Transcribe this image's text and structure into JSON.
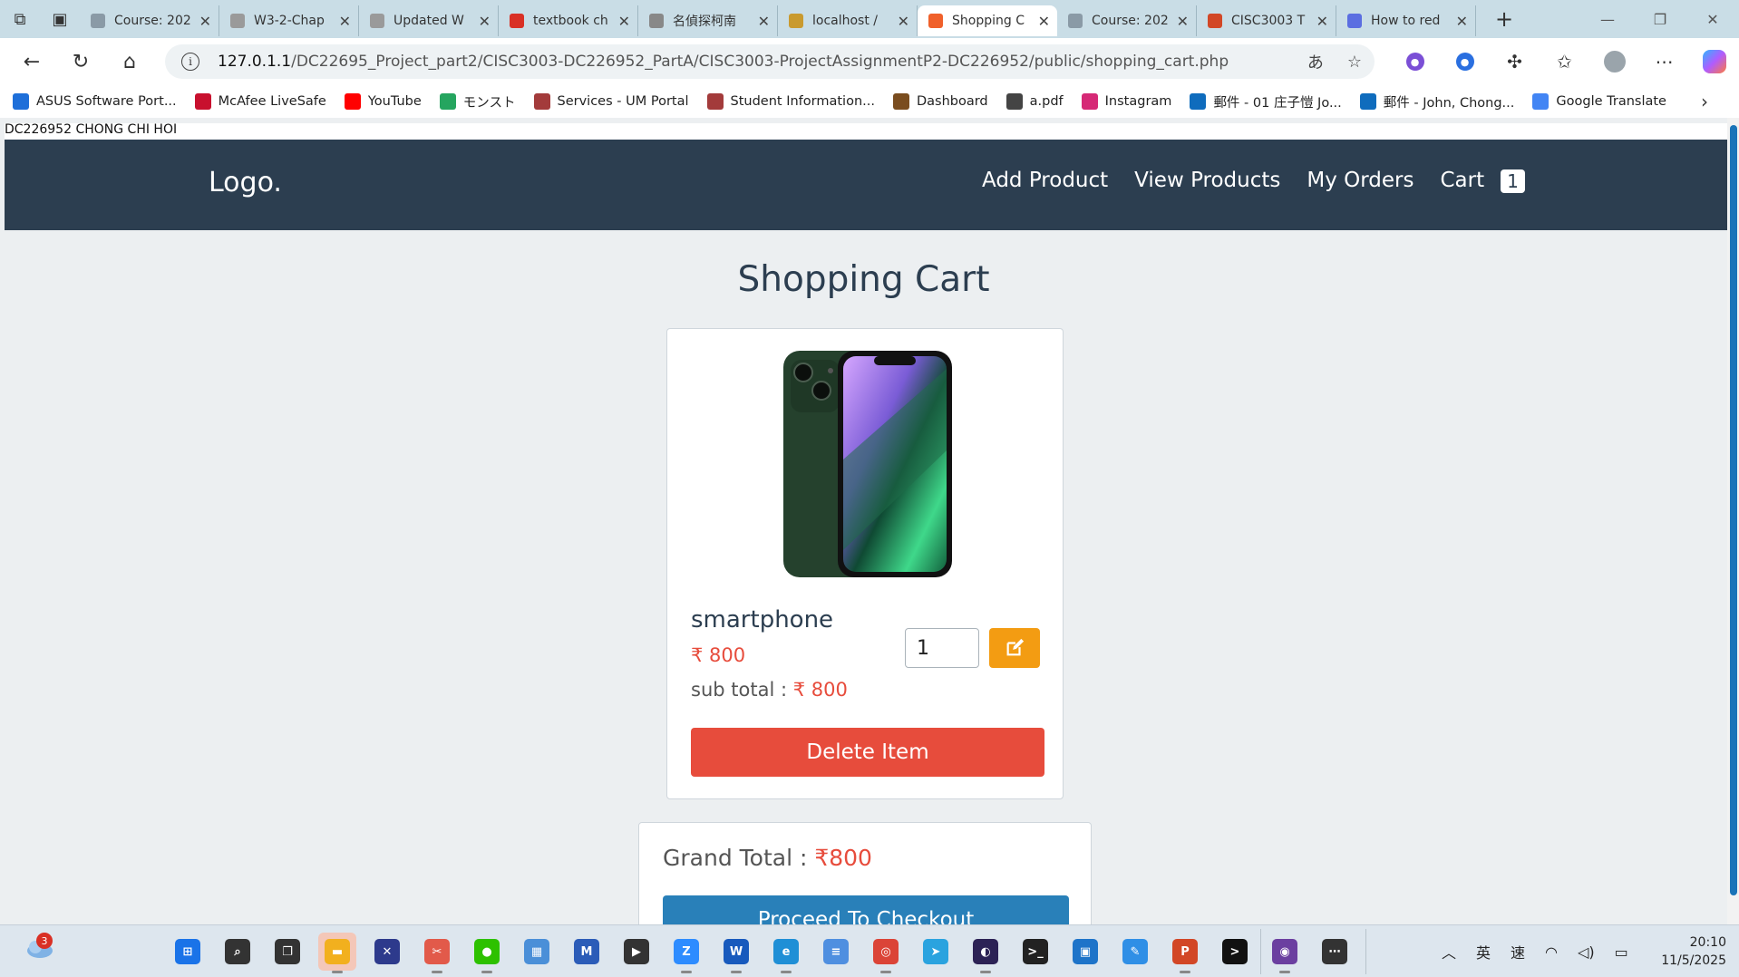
{
  "browser": {
    "tabs": [
      {
        "title": "Course: 202",
        "fav_color": "#8a9aa6",
        "active": false
      },
      {
        "title": "W3-2-Chap",
        "fav_color": "#9a9a9a",
        "active": false
      },
      {
        "title": "Updated W",
        "fav_color": "#9a9a9a",
        "active": false
      },
      {
        "title": "textbook ch",
        "fav_color": "#d93025",
        "active": false
      },
      {
        "title": "名偵探柯南",
        "fav_color": "#888888",
        "active": false
      },
      {
        "title": "localhost /",
        "fav_color": "#c99a2e",
        "active": false
      },
      {
        "title": "Shopping C",
        "fav_color": "#f0602a",
        "active": true
      },
      {
        "title": "Course: 202",
        "fav_color": "#8a9aa6",
        "active": false
      },
      {
        "title": "CISC3003 T",
        "fav_color": "#d24726",
        "active": false
      },
      {
        "title": "How to red",
        "fav_color": "#5b6ee1",
        "active": false
      }
    ],
    "url_host": "127.0.1.1",
    "url_path": "/DC22695_Project_part2/CISC3003-DC226952_PartA/CISC3003-ProjectAssignmentP2-DC226952/public/shopping_cart.php",
    "bookmarks": [
      {
        "label": "ASUS Software Port...",
        "color": "#1e6fd9",
        "icon": "asus-icon"
      },
      {
        "label": "McAfee LiveSafe",
        "color": "#c8102e",
        "icon": "mcafee-icon"
      },
      {
        "label": "YouTube",
        "color": "#ff0000",
        "icon": "youtube-icon"
      },
      {
        "label": "モンスト",
        "color": "#25a55f",
        "icon": "monst-icon"
      },
      {
        "label": "Services - UM Portal",
        "color": "#a33b3b",
        "icon": "um-portal-icon"
      },
      {
        "label": "Student Information...",
        "color": "#a33b3b",
        "icon": "um-student-icon"
      },
      {
        "label": "Dashboard",
        "color": "#7a4d1f",
        "icon": "dashboard-icon"
      },
      {
        "label": "a.pdf",
        "color": "#444444",
        "icon": "globe-icon"
      },
      {
        "label": "Instagram",
        "color": "#d62976",
        "icon": "instagram-icon"
      },
      {
        "label": "郵件 - 01 庄子愷 Jo...",
        "color": "#0f6cbd",
        "icon": "outlook-icon"
      },
      {
        "label": "郵件 - John, Chong...",
        "color": "#0f6cbd",
        "icon": "outlook-icon"
      },
      {
        "label": "Google Translate",
        "color": "#4285f4",
        "icon": "translate-icon"
      }
    ]
  },
  "page": {
    "student_line": "DC226952 CHONG CHI HOI",
    "logo": "Logo.",
    "nav": {
      "add_product": "Add Product",
      "view_products": "View Products",
      "my_orders": "My Orders",
      "cart": "Cart",
      "cart_count": "1"
    },
    "title": "Shopping Cart",
    "item": {
      "name": "smartphone",
      "price": "₹ 800",
      "subtotal_label": "sub total : ",
      "subtotal_value": "₹ 800",
      "quantity": "1",
      "delete_label": "Delete Item"
    },
    "grand_total_label": "Grand Total : ",
    "grand_total_value": "₹800",
    "checkout_label": "Proceed To Checkout"
  },
  "taskbar": {
    "notification_count": "3",
    "apps": [
      {
        "name": "start-icon",
        "color": "#1a73e8",
        "glyph": "⊞"
      },
      {
        "name": "search-icon",
        "color": "#333333",
        "glyph": "⌕"
      },
      {
        "name": "taskview-icon",
        "color": "#333333",
        "glyph": "❐"
      },
      {
        "name": "file-explorer-icon",
        "color": "#f2b01e",
        "glyph": "▬"
      },
      {
        "name": "xmind-icon",
        "color": "#2d3a8c",
        "glyph": "✕"
      },
      {
        "name": "snipping-tool-icon",
        "color": "#e25a4a",
        "glyph": "✂"
      },
      {
        "name": "wechat-icon",
        "color": "#2dc100",
        "glyph": "●"
      },
      {
        "name": "control-panel-icon",
        "color": "#4a8fd8",
        "glyph": "▦"
      },
      {
        "name": "vscode-like-icon",
        "color": "#2b5cb8",
        "glyph": "M"
      },
      {
        "name": "media-player-icon",
        "color": "#333333",
        "glyph": "▶"
      },
      {
        "name": "zoom-icon",
        "color": "#2d8cff",
        "glyph": "Z"
      },
      {
        "name": "word-icon",
        "color": "#185abd",
        "glyph": "W"
      },
      {
        "name": "edge-icon",
        "color": "#1f8fd6",
        "glyph": "e"
      },
      {
        "name": "notepad-icon",
        "color": "#4f8fe0",
        "glyph": "≡"
      },
      {
        "name": "chrome-icon",
        "color": "#db4437",
        "glyph": "◎"
      },
      {
        "name": "telegram-icon",
        "color": "#2aa3df",
        "glyph": "➤"
      },
      {
        "name": "eclipse-icon",
        "color": "#2c2255",
        "glyph": "◐"
      },
      {
        "name": "terminal-icon",
        "color": "#222222",
        "glyph": ">_"
      },
      {
        "name": "remote-desktop-icon",
        "color": "#1e74c9",
        "glyph": "▣"
      },
      {
        "name": "paint-icon",
        "color": "#2f8fe6",
        "glyph": "✎"
      },
      {
        "name": "powerpoint-icon",
        "color": "#d24726",
        "glyph": "P"
      },
      {
        "name": "cmd-icon",
        "color": "#111111",
        "glyph": ">"
      },
      {
        "name": "github-icon",
        "color": "#6b3fa0",
        "glyph": "◉"
      },
      {
        "name": "more-apps-icon",
        "color": "#333333",
        "glyph": "⋯"
      }
    ],
    "ime_lang": "英",
    "ime_mode": "速",
    "time": "20:10",
    "date": "11/5/2025"
  },
  "colors": {
    "header_bg": "#2c3e50",
    "price_red": "#e74c3c",
    "delete_red": "#e74c3c",
    "update_orange": "#f39c12",
    "checkout_blue": "#2980b9"
  }
}
